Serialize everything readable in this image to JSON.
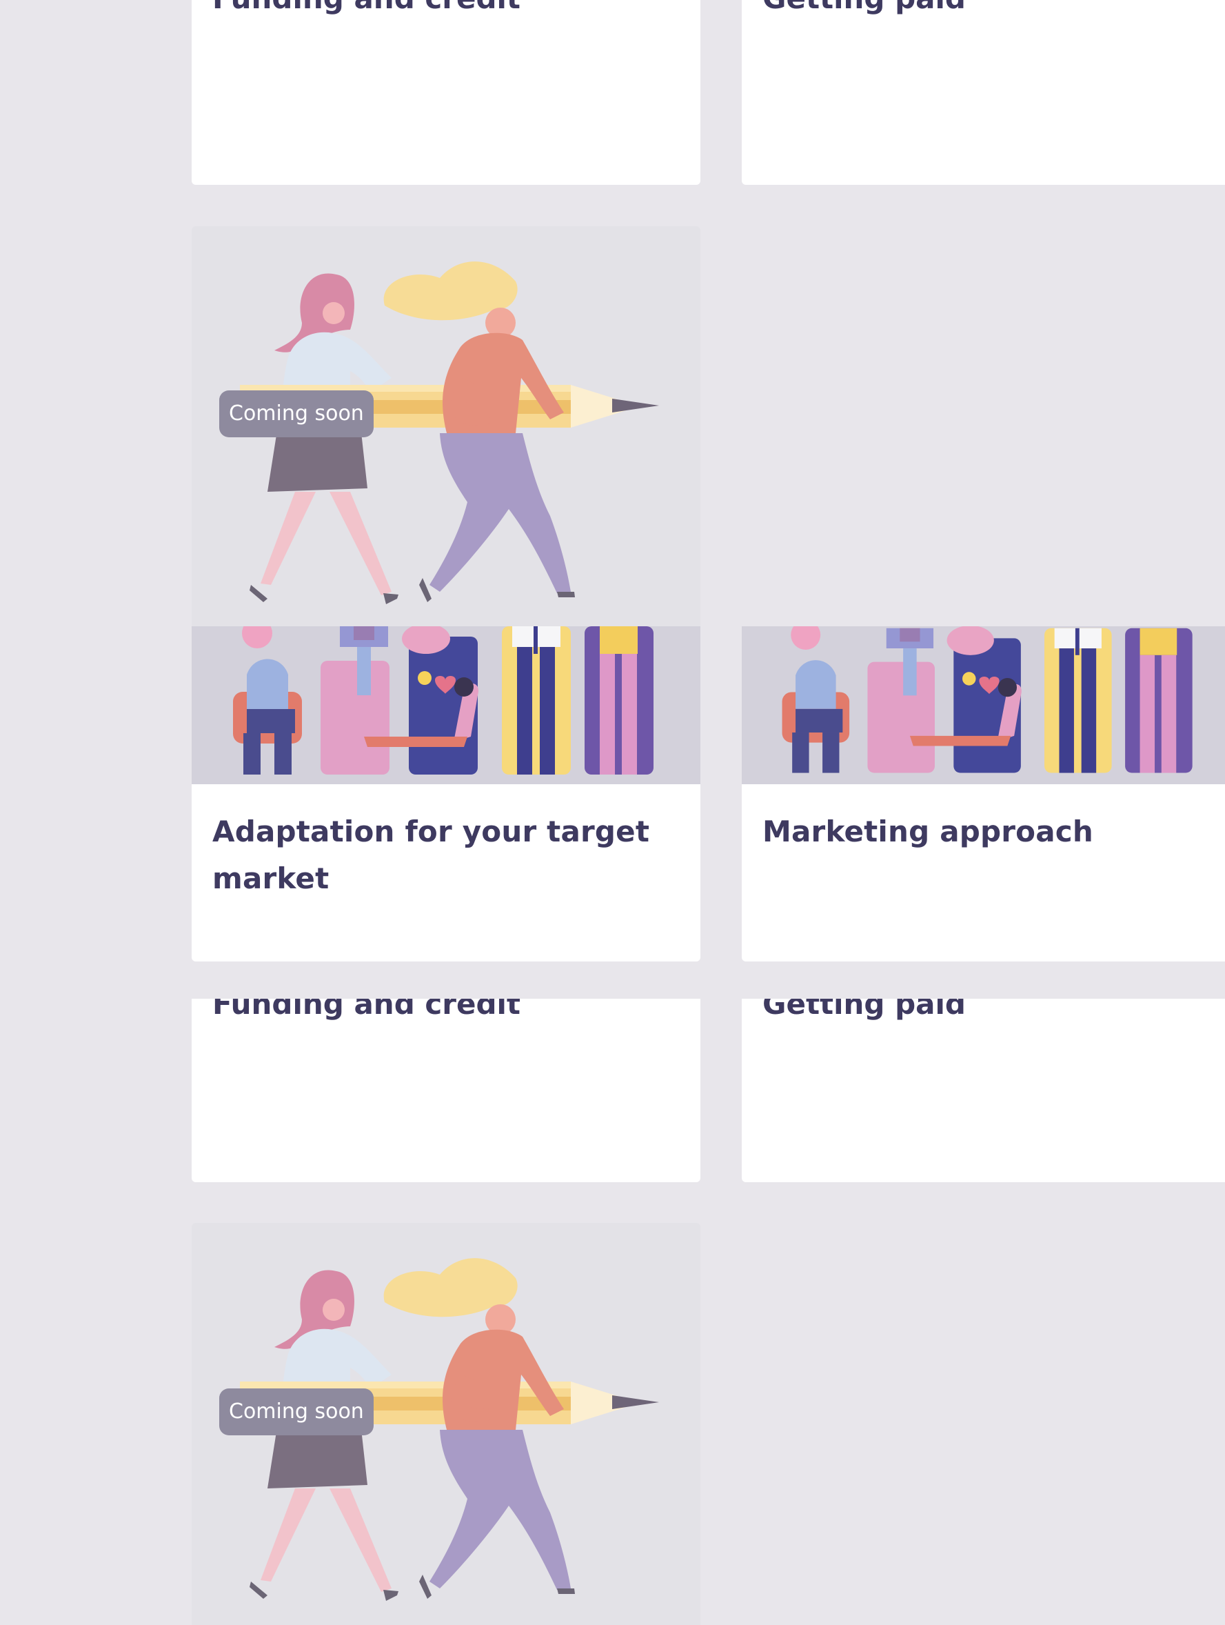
{
  "cards": {
    "top_left": {
      "title": "Funding and credit"
    },
    "top_right": {
      "title": "Getting paid"
    },
    "adaptation": {
      "title": "Adaptation for your target market"
    },
    "marketing": {
      "title": "Marketing approach"
    },
    "mid_left": {
      "title": "Funding and credit"
    },
    "mid_right": {
      "title": "Getting paid"
    }
  },
  "badges": {
    "coming_soon_1": "Coming soon",
    "coming_soon_2": "Coming soon"
  },
  "colors": {
    "background": "#E8E6EB",
    "card": "#FFFFFF",
    "title": "#3E3A60",
    "badge": "#8E8A9E",
    "coming_card": "#E3E2E7",
    "illustration_strip": "#D3D1DB"
  },
  "icons": [
    "pencil-carriers-illustration",
    "social-media-people-illustration"
  ]
}
